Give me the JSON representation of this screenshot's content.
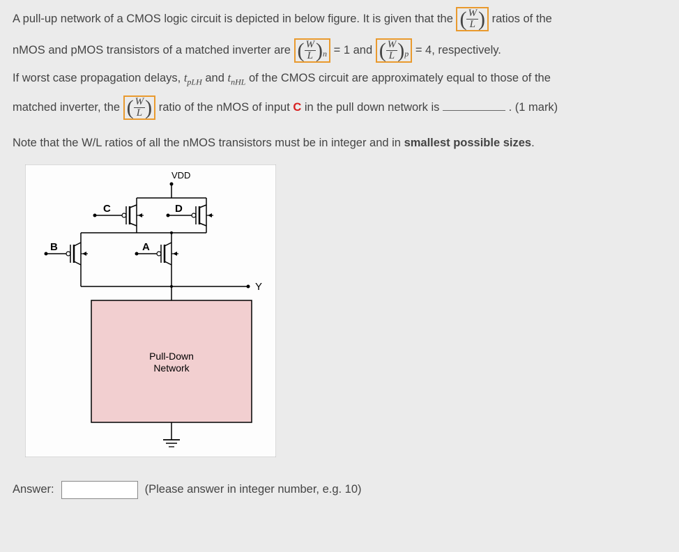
{
  "question": {
    "p1_a": "A pull-up network of a CMOS logic circuit is depicted in below figure. It is given that the ",
    "p1_b": " ratios of the",
    "p2_a": "nMOS and pMOS transistors of a matched inverter are ",
    "p2_b": " = 1  and  ",
    "p2_c": " = 4, respectively.",
    "p3_a": "If worst case propagation delays, ",
    "p3_b": " and ",
    "p3_c": " of the CMOS circuit are approximately equal to those of the",
    "p4_a": "matched inverter, the ",
    "p4_b": " ratio of the nMOS of input ",
    "p4_c": " in the pull down network is ",
    "p4_d": " . (1 mark)",
    "note": "Note that the W/L ratios of all the nMOS transistors must be in integer and in ",
    "note_bold": "smallest possible sizes",
    "note_end": ".",
    "input_C": "C",
    "tpLH_t": "t",
    "tpLH_sub": "pLH",
    "tnHL_t": "t",
    "tnHL_sub": "nHL",
    "W": "W",
    "L": "L",
    "sub_n": "n",
    "sub_p": "p"
  },
  "circuit": {
    "vdd": "VDD",
    "B": "B",
    "C": "C",
    "D": "D",
    "A": "A",
    "Y": "Y",
    "box": "Pull-Down\nNetwork"
  },
  "answer": {
    "label": "Answer:",
    "value": "",
    "hint": "(Please answer in integer number, e.g. 10)"
  }
}
